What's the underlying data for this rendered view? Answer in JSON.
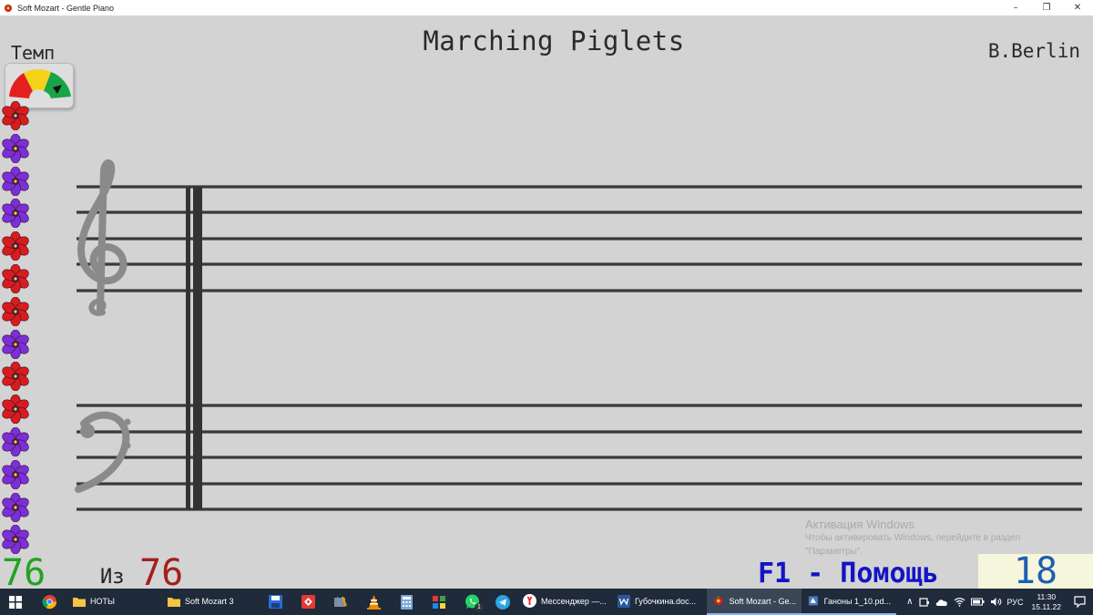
{
  "window": {
    "title": "Soft Mozart - Gentle Piano",
    "controls": {
      "minimize": "–",
      "maximize": "❐",
      "close": "✕"
    }
  },
  "piece": {
    "title": "Marching Piglets",
    "composer": "B.Berlin"
  },
  "tempo": {
    "label": "Темп",
    "dial_colors": [
      "#e41f1f",
      "#f5d21a",
      "#19a447"
    ]
  },
  "flowers": [
    "red",
    "purple",
    "purple",
    "purple",
    "red",
    "red",
    "red",
    "purple",
    "red",
    "red",
    "purple",
    "purple",
    "purple",
    "purple"
  ],
  "flower_colors": {
    "red": "#d81c1c",
    "purple": "#7b2fd6"
  },
  "progress": {
    "current": "76",
    "of_label": "Из",
    "total": "76"
  },
  "help_hint": "F1 - Помощь",
  "score": "18",
  "activation": {
    "title": "Активация Windows",
    "line1": "Чтобы активировать Windows, перейдите в раздел",
    "line2": "\"Параметры\"."
  },
  "taskbar": {
    "pinned_notes": "НОТЫ",
    "pinned_softmozart": "Soft Mozart 3",
    "messenger": "Мессенджер —...",
    "word_doc": "Губочкина.doc...",
    "softmozart_running": "Soft Mozart - Ge...",
    "pdf": "Ганоны 1_10.pd...",
    "whatsapp_badge": "1",
    "tray_lang": "РУС",
    "time": "11:30",
    "date": "15.11.22",
    "tray_arrow": "∧"
  }
}
